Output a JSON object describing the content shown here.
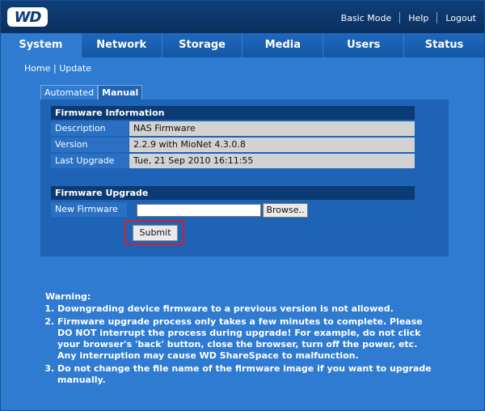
{
  "header": {
    "logo_text": "WD",
    "links": [
      "Basic Mode",
      "Help",
      "Logout"
    ]
  },
  "nav": {
    "items": [
      "System",
      "Network",
      "Storage",
      "Media",
      "Users",
      "Status"
    ],
    "active": "System"
  },
  "breadcrumb": [
    "Home",
    "Update"
  ],
  "tabs": [
    "Automated",
    "Manual"
  ],
  "firmware_info": {
    "title": "Firmware Information",
    "rows": [
      {
        "label": "Description",
        "value": "NAS Firmware"
      },
      {
        "label": "Version",
        "value": "2.2.9 with MioNet 4.3.0.8"
      },
      {
        "label": "Last Upgrade",
        "value": "Tue, 21 Sep 2010 16:11:55"
      }
    ]
  },
  "firmware_upgrade": {
    "title": "Firmware Upgrade",
    "new_firmware_label": "New Firmware",
    "file_value": "",
    "browse_label": "Browse..",
    "submit_label": "Submit"
  },
  "warning": {
    "title": "Warning:",
    "items": [
      "Downgrading device firmware to a previous version is not allowed.",
      "Firmware upgrade process only takes a few minutes to complete. Please DO NOT interrupt the process during upgrade! For example, do not click your browser's 'back' button, close the browser, turn off the power, etc. Any interruption may cause WD ShareSpace to malfunction.",
      "Do not change the file name of the firmware image if you want to upgrade manually."
    ]
  },
  "colors": {
    "background": "#2f7bd1",
    "header": "#0e3f7a",
    "highlight": "#d21f2a"
  }
}
